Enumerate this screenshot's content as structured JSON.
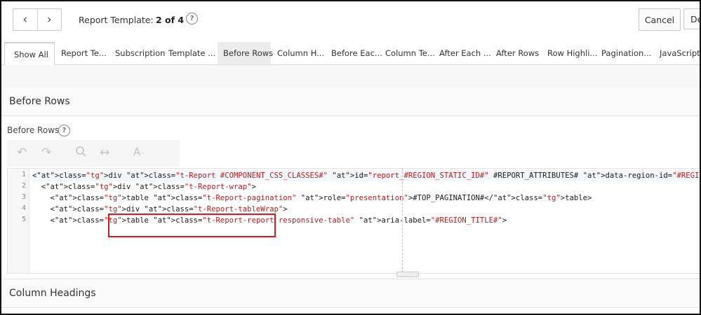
{
  "toolbar": {
    "prev_icon": "chevron-left-icon",
    "next_icon": "chevron-right-icon",
    "prev_glyph": "‹",
    "next_glyph": "›",
    "label": "Report Template:",
    "count": "2 of 4",
    "help_glyph": "?",
    "cancel_label": "Cancel",
    "d_label": "De"
  },
  "tabs": [
    {
      "label": "Show All",
      "state": "active"
    },
    {
      "label": "Report Te..."
    },
    {
      "label": "Subscription"
    },
    {
      "label": "Template ..."
    },
    {
      "label": "Before Rows",
      "state": "hover"
    },
    {
      "label": "Column H..."
    },
    {
      "label": "Before Eac..."
    },
    {
      "label": "Column Te..."
    },
    {
      "label": "After Each ..."
    },
    {
      "label": "After Rows"
    },
    {
      "label": "Row Highli..."
    },
    {
      "label": "Pagination..."
    },
    {
      "label": "JavaScript"
    }
  ],
  "sections": {
    "before_rows_header": "Before Rows",
    "column_headings_header": "Column Headings"
  },
  "field": {
    "label": "Before Rows",
    "help_glyph": "?"
  },
  "editor_toolbar": {
    "undo_icon": "undo-icon",
    "redo_icon": "redo-icon",
    "search_icon": "search-icon",
    "wrap_icon": "horizontal-arrows-icon",
    "font_icon": "font-size-icon"
  },
  "editor": {
    "line_numbers": [
      "1",
      "2",
      "3",
      "4",
      "5"
    ],
    "lines": [
      "<div class=\"t-Report #COMPONENT_CSS_CLASSES#\" id=\"report_#REGION_STATIC_ID#\" #REPORT_ATTRIBUTES# data-region-id=\"#REGION_STATIC_ID#\">",
      "  <div class=\"t-Report-wrap\">",
      "    <table class=\"t-Report-pagination\" role=\"presentation\">#TOP_PAGINATION#</table>",
      "    <div class=\"t-Report-tableWrap\">",
      "    <table class=\"t-Report-report responsive-table\" aria-label=\"#REGION_TITLE#\">"
    ]
  },
  "colors": {
    "highlight_box": "#e0151b",
    "tag": "#2a9d8f",
    "attribute": "#1e40af",
    "string": "#b81d1d"
  }
}
